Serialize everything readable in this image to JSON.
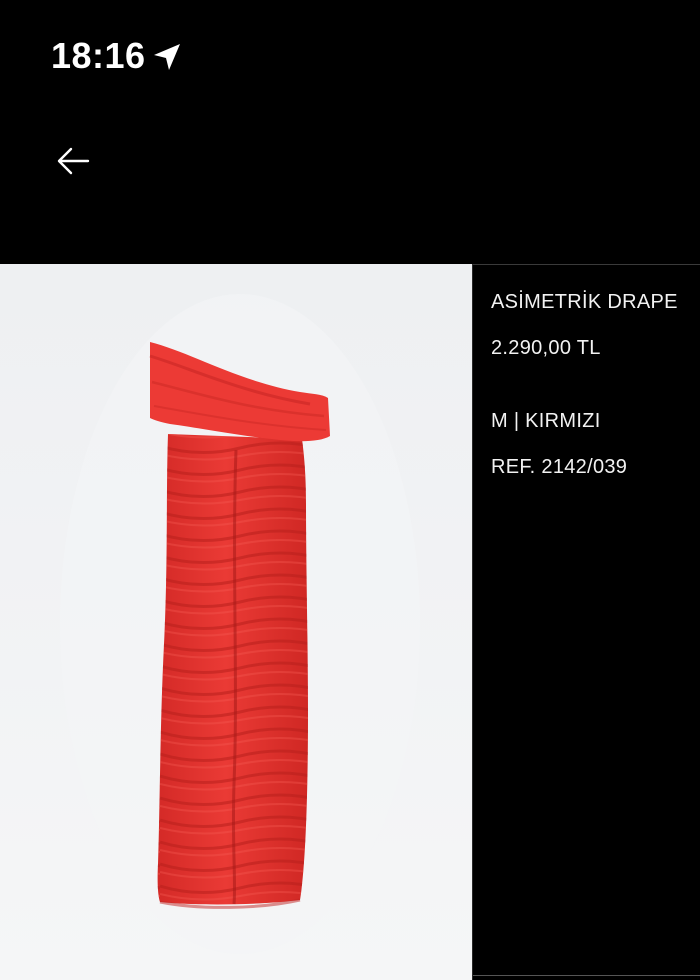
{
  "status_bar": {
    "time": "18:16"
  },
  "icons": {
    "location": "location-arrow-icon",
    "back": "arrow-left-icon"
  },
  "colors": {
    "background": "#000000",
    "dress": "#e8332f",
    "image_bg": "#f1f2f4"
  },
  "product": {
    "name": "ASİMETRİK DRAPE",
    "price": "2.290,00 TL",
    "variant": "M | KIRMIZI",
    "reference": "REF. 2142/039"
  }
}
